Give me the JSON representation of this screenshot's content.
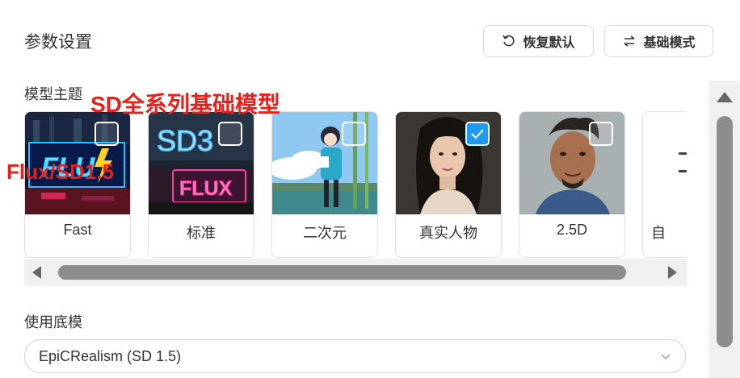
{
  "header": {
    "title": "参数设置",
    "restore_label": "恢复默认",
    "basic_mode_label": "基础模式"
  },
  "theme_section": {
    "label": "模型主题",
    "overlay_sd": "SD全系列基础模型",
    "overlay_flux": "Flux/SD1.5",
    "cards": [
      {
        "label": "Fast",
        "checked": false,
        "image": "flux-neon-sign"
      },
      {
        "label": "标准",
        "checked": false,
        "image": "sd3-flux-neon-sign"
      },
      {
        "label": "二次元",
        "checked": false,
        "image": "anime-girl"
      },
      {
        "label": "真实人物",
        "checked": true,
        "image": "realistic-woman-portrait"
      },
      {
        "label": "2.5D",
        "checked": false,
        "image": "painted-man-portrait"
      },
      {
        "label": "自",
        "checked": false,
        "image": "custom"
      }
    ]
  },
  "model_section": {
    "label": "使用底模",
    "selected": "EpiCRealism (SD 1.5)"
  },
  "colors": {
    "accent": "#1e9bf0",
    "annotation_red": "#e8201b"
  },
  "scrollbars": {
    "horizontal_position": 0.0,
    "vertical_position": 0.0
  }
}
